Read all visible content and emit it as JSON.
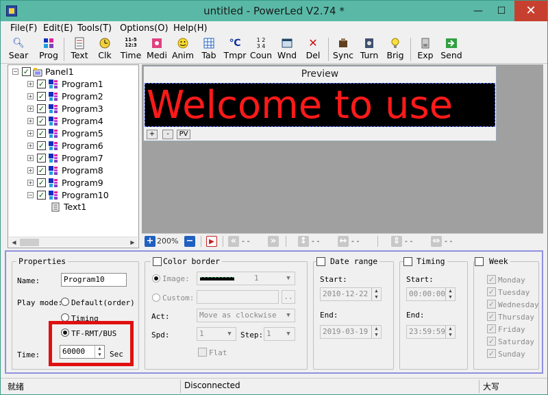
{
  "window": {
    "title": "untitled - PowerLed V2.74 *",
    "minimize": "—",
    "maximize": "☐",
    "close": "✕"
  },
  "menu": [
    "File(F)",
    "Edit(E)",
    "Tools(T)",
    "Options(O)",
    "Help(H)"
  ],
  "toolbar": [
    {
      "label": "Sear",
      "icon": "search-icon"
    },
    {
      "label": "Prog",
      "icon": "program-icon"
    },
    {
      "label": "Text",
      "icon": "text-icon"
    },
    {
      "label": "Clk",
      "icon": "clock-icon"
    },
    {
      "label": "Time",
      "icon": "time-icon"
    },
    {
      "label": "Medi",
      "icon": "media-icon"
    },
    {
      "label": "Anim",
      "icon": "animation-icon"
    },
    {
      "label": "Tab",
      "icon": "table-icon"
    },
    {
      "label": "Tmpr",
      "icon": "temperature-icon"
    },
    {
      "label": "Coun",
      "icon": "counter-icon"
    },
    {
      "label": "Wnd",
      "icon": "window-icon"
    },
    {
      "label": "Del",
      "icon": "delete-icon"
    },
    {
      "label": "Sync",
      "icon": "sync-icon"
    },
    {
      "label": "Turn",
      "icon": "turn-icon"
    },
    {
      "label": "Brig",
      "icon": "brightness-icon"
    },
    {
      "label": "Exp",
      "icon": "export-icon"
    },
    {
      "label": "Send",
      "icon": "send-icon"
    }
  ],
  "tree": {
    "root": "Panel1",
    "programs": [
      "Program1",
      "Program2",
      "Program3",
      "Program4",
      "Program5",
      "Program6",
      "Program7",
      "Program8",
      "Program9",
      "Program10"
    ],
    "child": "Text1"
  },
  "preview": {
    "title": "Preview",
    "led_text": "Welcome to use",
    "led_color": "#ff1a1a",
    "buttons": [
      "+",
      "-",
      "PV"
    ]
  },
  "zoombar": {
    "zoom": "200%",
    "dash": "- -"
  },
  "properties": {
    "title": "Properties",
    "name_label": "Name:",
    "name_value": "Program10",
    "play_mode_label": "Play mode:",
    "mode_default": "Default(order)",
    "mode_timing": "Timing",
    "mode_tf": "TF-RMT/BUS",
    "time_label": "Time:",
    "time_value": "60000",
    "time_unit": "Sec"
  },
  "border": {
    "title": "Color border",
    "image_label": "Image:",
    "image_value": "1",
    "custom_label": "Custom:",
    "custom_btn": "..",
    "act_label": "Act:",
    "act_value": "Move as clockwise",
    "spd_label": "Spd:",
    "spd_value": "1",
    "step_label": "Step:",
    "step_value": "1",
    "flat_label": "Flat"
  },
  "date_range": {
    "title": "Date range",
    "start_label": "Start:",
    "start_value": "2010-12-22",
    "end_label": "End:",
    "end_value": "2019-03-19"
  },
  "timing": {
    "title": "Timing",
    "start_label": "Start:",
    "start_value": "00:00:00",
    "end_label": "End:",
    "end_value": "23:59:59"
  },
  "week": {
    "title": "Week",
    "days": [
      "Monday",
      "Tuesday",
      "Wednesday",
      "Thursday",
      "Friday",
      "Saturday",
      "Sunday"
    ]
  },
  "status": {
    "ready": "就绪",
    "connection": "Disconnected",
    "caps": "大写"
  }
}
